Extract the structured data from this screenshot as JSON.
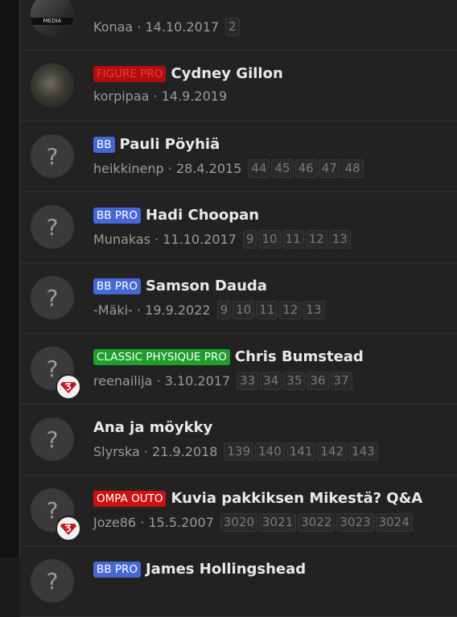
{
  "threads": [
    {
      "avatar": "photo2",
      "avatar_text": "MEDIA",
      "prefix": "",
      "prefix_class": "",
      "title": "",
      "author": "Konaa",
      "date": "14.10.2017",
      "pages": [
        "2"
      ],
      "badge": false
    },
    {
      "avatar": "photo",
      "prefix": "FIGURE PRO",
      "prefix_class": "p-figure",
      "title": "Cydney Gillon",
      "author": "korpipaa",
      "date": "14.9.2019",
      "pages": [],
      "badge": false
    },
    {
      "avatar": "default",
      "prefix": "BB",
      "prefix_class": "p-bb",
      "title": "Pauli Pöyhiä",
      "author": "heikkinenp",
      "date": "28.4.2015",
      "pages": [
        "44",
        "45",
        "46",
        "47",
        "48"
      ],
      "badge": false
    },
    {
      "avatar": "default",
      "prefix": "BB PRO",
      "prefix_class": "p-bb",
      "title": "Hadi Choopan",
      "author": "Munakas",
      "date": "11.10.2017",
      "pages": [
        "9",
        "10",
        "11",
        "12",
        "13"
      ],
      "badge": false
    },
    {
      "avatar": "default",
      "prefix": "BB PRO",
      "prefix_class": "p-bb",
      "title": "Samson Dauda",
      "author": "-Mäki-",
      "date": "19.9.2022",
      "pages": [
        "9",
        "10",
        "11",
        "12",
        "13"
      ],
      "badge": false
    },
    {
      "avatar": "default",
      "prefix": "CLASSIC PHYSIQUE PRO",
      "prefix_class": "p-classic",
      "title": "Chris Bumstead",
      "author": "reenailija",
      "date": "3.10.2017",
      "pages": [
        "33",
        "34",
        "35",
        "36",
        "37"
      ],
      "badge": true
    },
    {
      "avatar": "default",
      "prefix": "",
      "prefix_class": "",
      "title": "Ana ja möykky",
      "author": "Slyrska",
      "date": "21.9.2018",
      "pages": [
        "139",
        "140",
        "141",
        "142",
        "143"
      ],
      "badge": false
    },
    {
      "avatar": "default",
      "prefix": "OMPA OUTO",
      "prefix_class": "p-red",
      "title": "Kuvia pakkiksen Mikestä? Q&A",
      "author": "Joze86",
      "date": "15.5.2007",
      "pages": [
        "3020",
        "3021",
        "3022",
        "3023",
        "3024"
      ],
      "badge": true
    },
    {
      "avatar": "default",
      "prefix": "BB PRO",
      "prefix_class": "p-bb",
      "title": "James Hollingshead",
      "author": "",
      "date": "",
      "pages": [],
      "badge": false
    }
  ],
  "meta_separator": " · ",
  "default_avatar_glyph": "?",
  "colors": {
    "accent_bb": "#4667d6",
    "classic": "#1d9f2c",
    "red": "#cc1111"
  }
}
